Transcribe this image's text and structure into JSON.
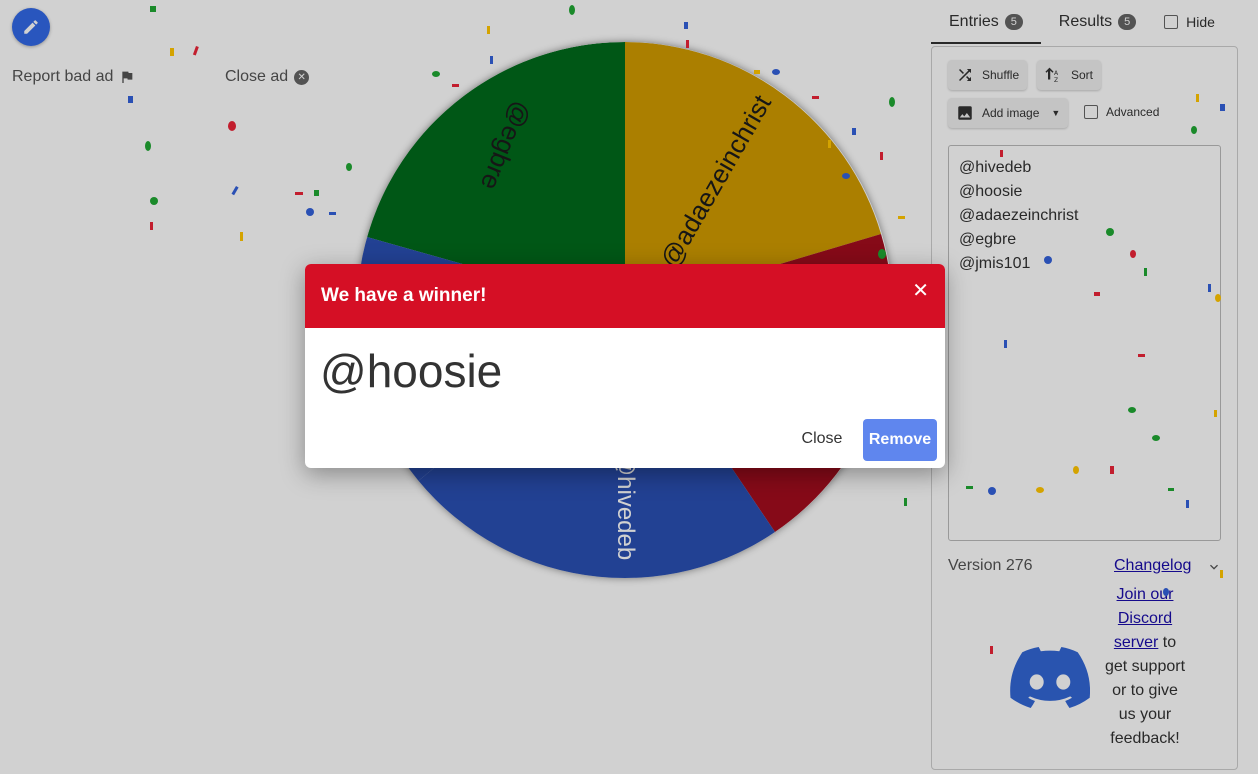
{
  "left": {
    "report_ad": "Report bad ad",
    "close_ad": "Close ad"
  },
  "wheel": {
    "slices": [
      {
        "name": "@egbre",
        "color": "#006b1b"
      },
      {
        "name": "@adaezeinchrist",
        "color": "#d19b00"
      },
      {
        "name": "@jmis101",
        "color": "#a40d1e"
      },
      {
        "name": "@hivedeb",
        "color": "#2a50b4"
      },
      {
        "name": "@hoosie",
        "color": "#2a50b4"
      }
    ],
    "visible_labels": {
      "egbre": "@egbre",
      "adaezeinchrist": "@adaezeinchrist",
      "hivedeb": "@hivedeb"
    }
  },
  "tabs": {
    "entries_label": "Entries",
    "entries_count": "5",
    "results_label": "Results",
    "results_count": "5",
    "hide_label": "Hide"
  },
  "toolbar": {
    "shuffle": "Shuffle",
    "sort": "Sort",
    "add_image": "Add image",
    "advanced": "Advanced"
  },
  "entries": [
    "@hivedeb",
    "@hoosie",
    "@adaezeinchrist",
    "@egbre",
    "@jmis101"
  ],
  "footer": {
    "version": "Version 276",
    "changelog": "Changelog",
    "discord_link": "Join our Discord server",
    "discord_rest": " to get support or to give us your feedback!"
  },
  "dialog": {
    "title": "We have a winner!",
    "winner": "@hoosie",
    "close_label": "Close",
    "remove_label": "Remove"
  },
  "colors": {
    "header_red": "#d50f25",
    "remove_blue": "#5f86ee",
    "fab_blue": "#3369e8"
  }
}
